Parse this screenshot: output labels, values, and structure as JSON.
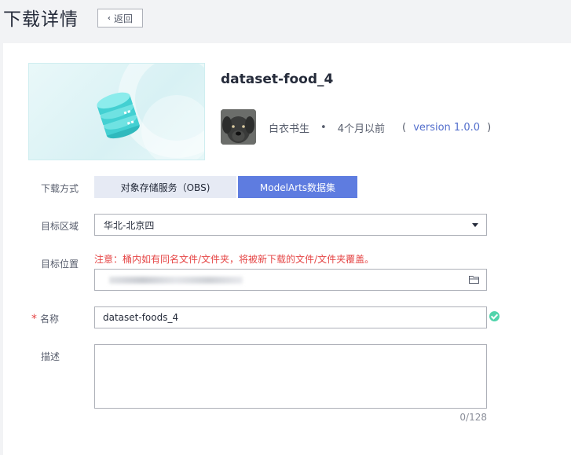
{
  "header": {
    "title": "下载详情",
    "back_label": "返回"
  },
  "dataset": {
    "name": "dataset-food_4",
    "author": "白衣书生",
    "separator": "•",
    "time_ago": "4个月以前",
    "version_open": "(",
    "version": "version 1.0.0",
    "version_close": ")"
  },
  "form": {
    "download_method": {
      "label": "下载方式",
      "options": [
        "对象存储服务（OBS)",
        "ModelArts数据集"
      ],
      "selected": "ModelArts数据集"
    },
    "target_region": {
      "label": "目标区域",
      "value": "华北-北京四"
    },
    "target_location": {
      "label": "目标位置",
      "notice": "注意：桶内如有同名文件/文件夹，将被新下载的文件/文件夹覆盖。"
    },
    "name": {
      "required_mark": "*",
      "label": "名称",
      "value": "dataset-foods_4"
    },
    "description": {
      "label": "描述",
      "value": "",
      "counter": "0/128"
    }
  },
  "colors": {
    "accent": "#5e7ce0",
    "link": "#526ecc",
    "error": "#e54545",
    "success": "#50d4ab"
  }
}
